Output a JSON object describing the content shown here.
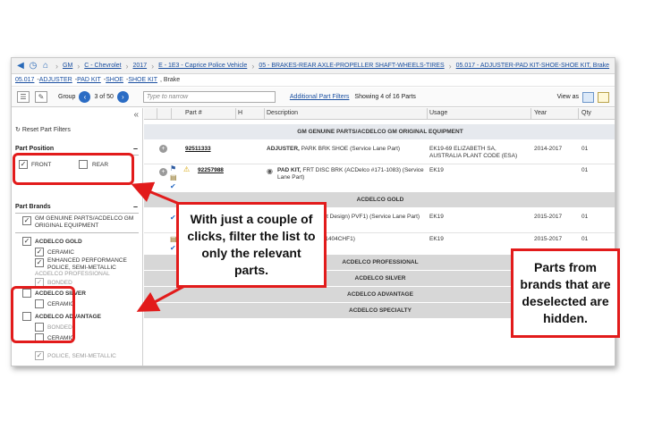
{
  "breadcrumb": {
    "items": [
      "GM",
      "C - Chevrolet",
      "2017",
      "E - 1E3 - Caprice Police Vehicle",
      "05 - BRAKES-REAR AXLE-PROPELLER SHAFT-WHEELS-TIRES",
      "05.017 - ADJUSTER-PAD KIT-SHOE-SHOE KIT, Brake"
    ]
  },
  "titlebar": {
    "links": [
      "05.017",
      "ADJUSTER",
      "PAD KIT",
      "SHOE",
      "SHOE KIT"
    ],
    "tail": ", Brake"
  },
  "toolbar": {
    "group_label": "Group",
    "group_count": "3 of 50",
    "narrow_placeholder": "Type to narrow",
    "additional_filters": "Additional Part Filters",
    "showing": "Showing 4 of 16 Parts",
    "view_as": "View as"
  },
  "sidebar": {
    "reset": "Reset Part Filters",
    "position_title": "Part Position",
    "position_options": [
      {
        "label": "FRONT",
        "checked": true
      },
      {
        "label": "REAR",
        "checked": false
      }
    ],
    "brands_title": "Part Brands",
    "brands": [
      {
        "label": "GM GENUINE PARTS/ACDELCO GM ORIGINAL EQUIPMENT",
        "checked": true
      },
      {
        "label": "ACDELCO GOLD",
        "checked": true
      },
      {
        "label": "CERAMIC",
        "checked": true
      },
      {
        "label": "ENHANCED PERFORMANCE POLICE, SEMI-METALLIC",
        "checked": true
      },
      {
        "label": "ACDELCO PROFESSIONAL",
        "checked": true
      },
      {
        "label": "BONDED",
        "checked": true
      },
      {
        "label": "ACDELCO SILVER",
        "checked": false
      },
      {
        "label": "CERAMIC",
        "checked": false
      },
      {
        "label": "ACDELCO ADVANTAGE",
        "checked": false
      },
      {
        "label": "BONDED",
        "checked": false
      },
      {
        "label": "CERAMIC",
        "checked": false
      },
      {
        "label": "POLICE, SEMI-METALLIC",
        "checked": true
      }
    ]
  },
  "table": {
    "headers": [
      "Part #",
      "H",
      "Description",
      "Usage",
      "Year",
      "Qty"
    ],
    "groups": [
      "GM GENUINE PARTS/ACDELCO GM ORIGINAL EQUIPMENT",
      "ACDELCO GOLD",
      "ACDELCO PROFESSIONAL",
      "ACDELCO SILVER",
      "ACDELCO ADVANTAGE",
      "ACDELCO SPECIALTY"
    ],
    "rows": [
      {
        "part": "92511333",
        "desc_bold": "ADJUSTER,",
        "desc": " PARK BRK SHOE (Service Lane Part)",
        "usage": "EK19-69 ELIZABETH SA, AUSTRALIA PLANT CODE (ESA)",
        "year": "2014-2017",
        "qty": "01"
      },
      {
        "part": "92257988",
        "desc_bold": "PAD KIT,",
        "desc": " FRT DISC BRK (ACDelco #171-1083) (Service Lane Part)",
        "usage": "EK19",
        "year": "",
        "qty": "01"
      },
      {
        "part": "",
        "desc_bold": "",
        "desc": "RONT (Revised F1 Part Design) PVF1) (Service Lane Part)",
        "usage": "EK19",
        "year": "2015-2017",
        "qty": "01"
      },
      {
        "part": "",
        "desc_bold": "",
        "desc": "RONT (ACDelco #17D1404CHF1)",
        "usage": "EK19",
        "year": "2015-2017",
        "qty": "01"
      }
    ]
  },
  "callouts": {
    "filter": "With just a couple of clicks, filter the list to only the relevant parts.",
    "hidden": "Parts from brands that are deselected are hidden."
  },
  "colors": {
    "annotation_red": "#e21b1b",
    "link_blue": "#1a4fa0"
  }
}
